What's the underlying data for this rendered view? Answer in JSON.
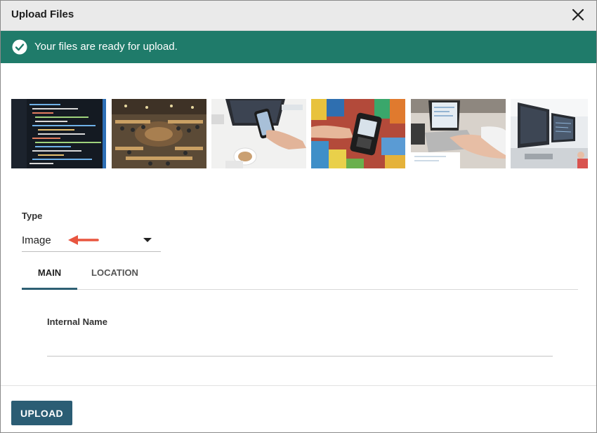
{
  "dialog": {
    "title": "Upload Files",
    "close_icon": "close-icon"
  },
  "banner": {
    "message": "Your files are ready for upload.",
    "icon": "check-circle-icon",
    "color": "#1f7b6a"
  },
  "thumbnails": [
    {
      "subject": "code on screen"
    },
    {
      "subject": "library reading room"
    },
    {
      "subject": "phone over laptop with coffee"
    },
    {
      "subject": "card reader payment"
    },
    {
      "subject": "hands typing on laptop"
    },
    {
      "subject": "office desks with monitors"
    }
  ],
  "type_field": {
    "label": "Type",
    "value": "Image",
    "dropdown_icon": "caret-down-icon",
    "annotation_icon": "red-arrow-icon"
  },
  "tabs": [
    {
      "label": "MAIN",
      "active": true
    },
    {
      "label": "LOCATION",
      "active": false
    }
  ],
  "main_tab": {
    "internal_name_label": "Internal Name",
    "internal_name_value": ""
  },
  "footer": {
    "upload_label": "UPLOAD",
    "accent": "#2b5d74"
  }
}
